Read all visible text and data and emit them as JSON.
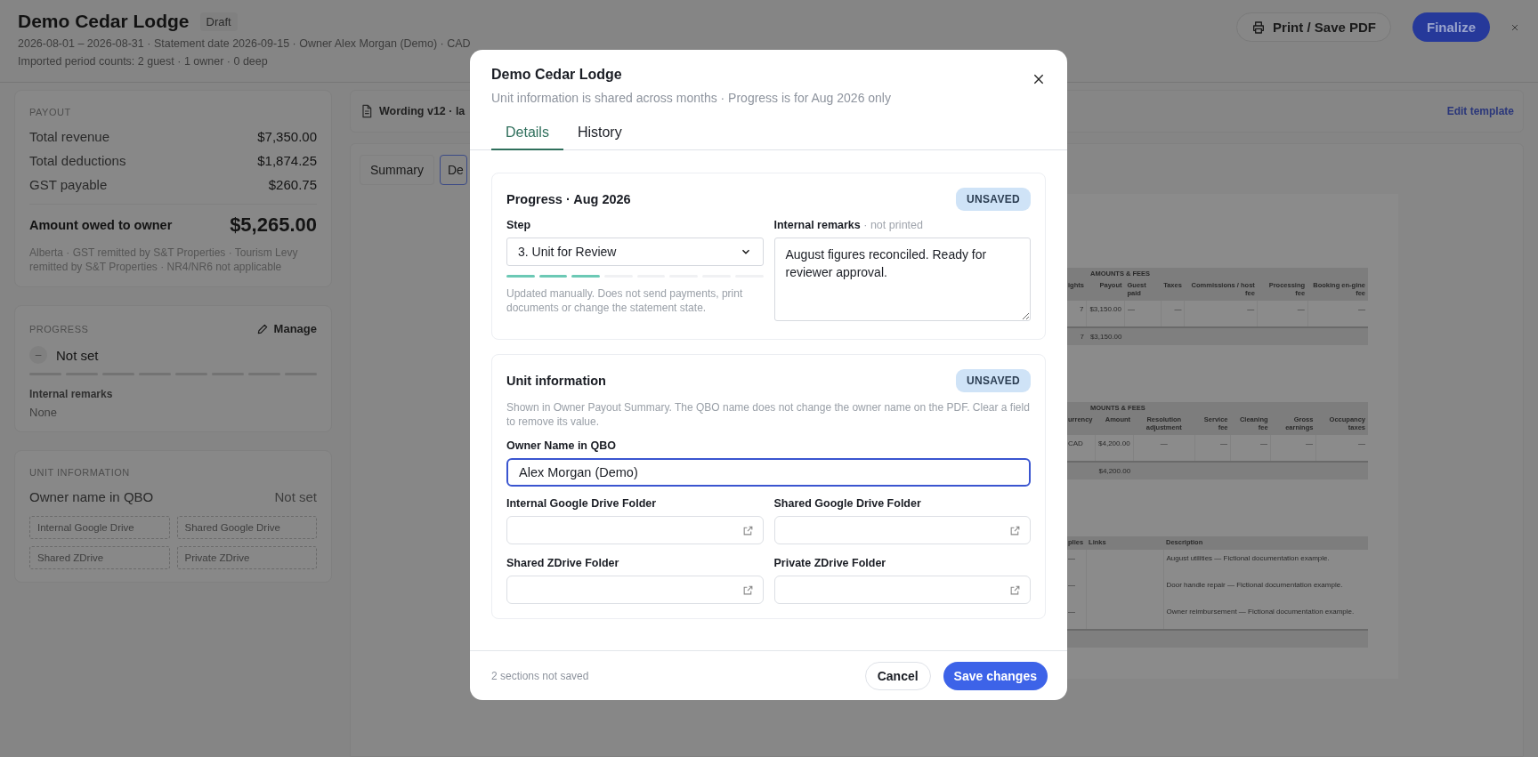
{
  "header": {
    "title": "Demo Cedar Lodge",
    "status_badge": "Draft",
    "meta_line": "2026-08-01 – 2026-08-31 · Statement date 2026-09-15 · Owner Alex Morgan (Demo) · CAD",
    "counts_line": "Imported period counts: 2 guest · 1 owner · 0 deep",
    "print_button": "Print / Save PDF",
    "finalize_button": "Finalize"
  },
  "payout": {
    "heading": "PAYOUT",
    "rows": [
      {
        "label": "Total revenue",
        "value": "$7,350.00"
      },
      {
        "label": "Total deductions",
        "value": "$1,874.25"
      },
      {
        "label": "GST payable",
        "value": "$260.75"
      }
    ],
    "total": {
      "label": "Amount owed to owner",
      "value": "$5,265.00"
    },
    "note": "Alberta · GST remitted by S&T Properties · Tourism Levy remitted by S&T Properties · NR4/NR6 not applicable"
  },
  "progress_panel": {
    "heading": "PROGRESS",
    "manage": "Manage",
    "status_icon": "–",
    "status": "Not set",
    "segments": [
      {
        "filled": false
      },
      {
        "filled": false
      },
      {
        "filled": false
      },
      {
        "filled": false
      },
      {
        "filled": false
      },
      {
        "filled": false
      },
      {
        "filled": false
      },
      {
        "filled": false
      }
    ],
    "remarks_label": "Internal remarks",
    "remarks_value": "None"
  },
  "unit_panel": {
    "heading": "UNIT INFORMATION",
    "owner_label": "Owner name in QBO",
    "owner_value": "Not set",
    "folders": [
      {
        "placeholder": "Internal Google Drive"
      },
      {
        "placeholder": "Shared Google Drive"
      },
      {
        "placeholder": "Shared ZDrive"
      },
      {
        "placeholder": "Private ZDrive"
      }
    ]
  },
  "document": {
    "toolbar_title": "Wording v12 · la",
    "edit_link": "Edit template",
    "tabs": [
      {
        "label": "Summary",
        "selected": false
      },
      {
        "label": "De",
        "selected": true
      }
    ],
    "tables": [
      {
        "group": "AMOUNTS & FEES",
        "columns": [
          {
            "label": "ights",
            "kind": "number"
          },
          {
            "label": "Payout",
            "kind": "number"
          },
          {
            "label": "Guest paid",
            "kind": "text"
          },
          {
            "label": "Taxes",
            "kind": "number"
          },
          {
            "label": "Commissions / host fee",
            "kind": "number"
          },
          {
            "label": "Processing fee",
            "kind": "number"
          },
          {
            "label": "Booking en-gine fee",
            "kind": "number"
          }
        ],
        "rows": [
          {
            "column_1": "7",
            "column_2": "$3,150.00",
            "column_3": "—",
            "column_4": "—",
            "column_5": "—",
            "column_6": "—",
            "column_7": "—"
          }
        ],
        "total": {
          "column_1": "7",
          "column_2": "$3,150.00"
        }
      },
      {
        "group": "MOUNTS & FEES",
        "columns": [
          {
            "label": "urrency",
            "kind": "text"
          },
          {
            "label": "Amount",
            "kind": "number"
          },
          {
            "label": "Resolution adjustment",
            "kind": "center"
          },
          {
            "label": "Service fee",
            "kind": "number"
          },
          {
            "label": "Cleaning fee",
            "kind": "number"
          },
          {
            "label": "Gross earnings",
            "kind": "number"
          },
          {
            "label": "Occupancy taxes",
            "kind": "number"
          }
        ],
        "rows": [
          {
            "column_1": "CAD",
            "column_2": "$4,200.00",
            "column_3": "—",
            "column_4": "—",
            "column_5": "—",
            "column_6": "—",
            "column_7": "—"
          }
        ],
        "total": {
          "column_2": "$4,200.00"
        }
      },
      {
        "columns": [
          {
            "label": "plies",
            "kind": "narrow"
          },
          {
            "label": "Links",
            "kind": "text"
          },
          {
            "label": "Description",
            "kind": "wide"
          }
        ],
        "rows": [
          {
            "column_1": "—",
            "column_3": "August utilities — Fictional documentation example."
          },
          {
            "column_1": "—",
            "column_3": "Door handle repair — Fictional documentation example."
          },
          {
            "column_1": "—",
            "column_3": "Owner reimbursement — Fictional documentation example."
          }
        ],
        "total_row": true
      }
    ]
  },
  "modal": {
    "title": "Demo Cedar Lodge",
    "subtitle": "Unit information is shared across months · Progress is for Aug 2026 only",
    "tabs": [
      {
        "label": "Details",
        "selected": true
      },
      {
        "label": "History",
        "selected": false
      }
    ],
    "progress_section": {
      "title": "Progress · Aug 2026",
      "badge": "UNSAVED",
      "step_label": "Step",
      "step_value": "3. Unit for Review",
      "segments": [
        {
          "filled": true
        },
        {
          "filled": true
        },
        {
          "filled": true
        },
        {
          "filled": false
        },
        {
          "filled": false
        },
        {
          "filled": false
        },
        {
          "filled": false
        },
        {
          "filled": false
        }
      ],
      "help": "Updated manually. Does not send payments, print documents or change the statement state.",
      "remarks_label": "Internal remarks",
      "remarks_hint": "· not printed",
      "remarks_value": "August figures reconciled. Ready for reviewer approval."
    },
    "unit_section": {
      "title": "Unit information",
      "badge": "UNSAVED",
      "help": "Shown in Owner Payout Summary. The QBO name does not change the owner name on the PDF. Clear a field to remove its value.",
      "owner_label": "Owner Name in QBO",
      "owner_value": "Alex Morgan (Demo)",
      "owner_focused": true,
      "folders": [
        {
          "label": "Internal Google Drive Folder"
        },
        {
          "label": "Shared Google Drive Folder"
        },
        {
          "label": "Shared ZDrive Folder"
        },
        {
          "label": "Private ZDrive Folder"
        }
      ]
    },
    "footer": {
      "status": "2 sections not saved",
      "cancel": "Cancel",
      "save": "Save changes"
    }
  }
}
